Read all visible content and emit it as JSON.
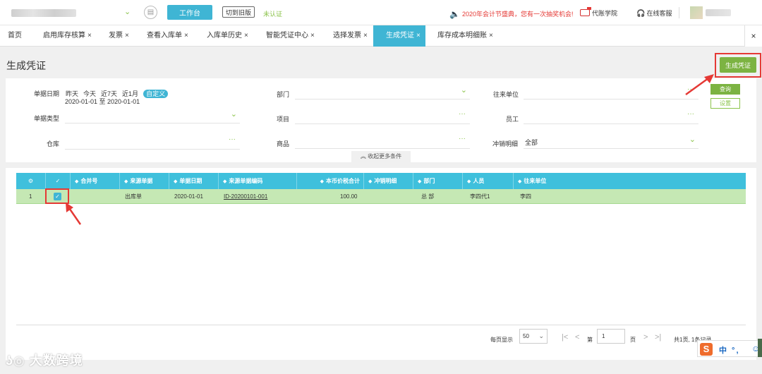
{
  "topbar": {
    "company_icon": "circle-doc-icon",
    "workbench": "工作台",
    "old_version": "切到旧版",
    "status": "未认证",
    "promo": "2020年会计节盛典，您有一次抽奖机会!",
    "academy": "代账学院",
    "service": "在线客服"
  },
  "tabs": [
    {
      "label": "首页"
    },
    {
      "label": "启用库存核算",
      "close": "×"
    },
    {
      "label": "发票",
      "close": "×"
    },
    {
      "label": "查看入库单",
      "close": "×"
    },
    {
      "label": "入库单历史",
      "close": "×"
    },
    {
      "label": "智能凭证中心",
      "close": "×"
    },
    {
      "label": "选择发票",
      "close": "×"
    },
    {
      "label": "生成凭证",
      "close": "×"
    },
    {
      "label": "库存成本明细账",
      "close": "×"
    }
  ],
  "close_all": "×",
  "page": {
    "title": "生成凭证",
    "generate_button": "生成凭证"
  },
  "filters": {
    "doc_date_label": "单据日期",
    "date_options": [
      "昨天",
      "今天",
      "近7天",
      "近1月"
    ],
    "date_custom": "自定义",
    "date_range": "2020-01-01 至 2020-01-01",
    "doc_type_label": "单据类型",
    "warehouse_label": "仓库",
    "department_label": "部门",
    "project_label": "项目",
    "product_label": "商品",
    "partner_label": "往来单位",
    "employee_label": "员工",
    "writeoff_label": "冲销明细",
    "writeoff_value": "全部",
    "dots": "···",
    "query_button": "查询",
    "settings_button": "设置",
    "collapse": "收起更多条件"
  },
  "table": {
    "headers": [
      "合并号",
      "来源单据",
      "单据日期",
      "来源单据编码",
      "本币价税合计",
      "冲销明细",
      "部门",
      "人员",
      "往来单位"
    ],
    "rows": [
      {
        "index": "1",
        "merge_no": "",
        "source_doc": "出库单",
        "doc_date": "2020-01-01",
        "source_code": "ID-20200101-001",
        "amount": "100.00",
        "writeoff": "",
        "department": "总 部",
        "person": "李四代1",
        "partner": "李四"
      }
    ]
  },
  "pager": {
    "per_page_label": "每页显示",
    "per_page": "50",
    "page_prefix": "第",
    "page": "1",
    "page_suffix": "页",
    "summary": "共1页, 1条记录"
  },
  "ime": {
    "logo": "S",
    "text": "中 °,"
  },
  "watermark": "大数跨境",
  "colors": {
    "accent": "#3fb5d4",
    "green": "#7cb342",
    "row_highlight": "#c5e8b4",
    "annotation": "#e53935"
  }
}
